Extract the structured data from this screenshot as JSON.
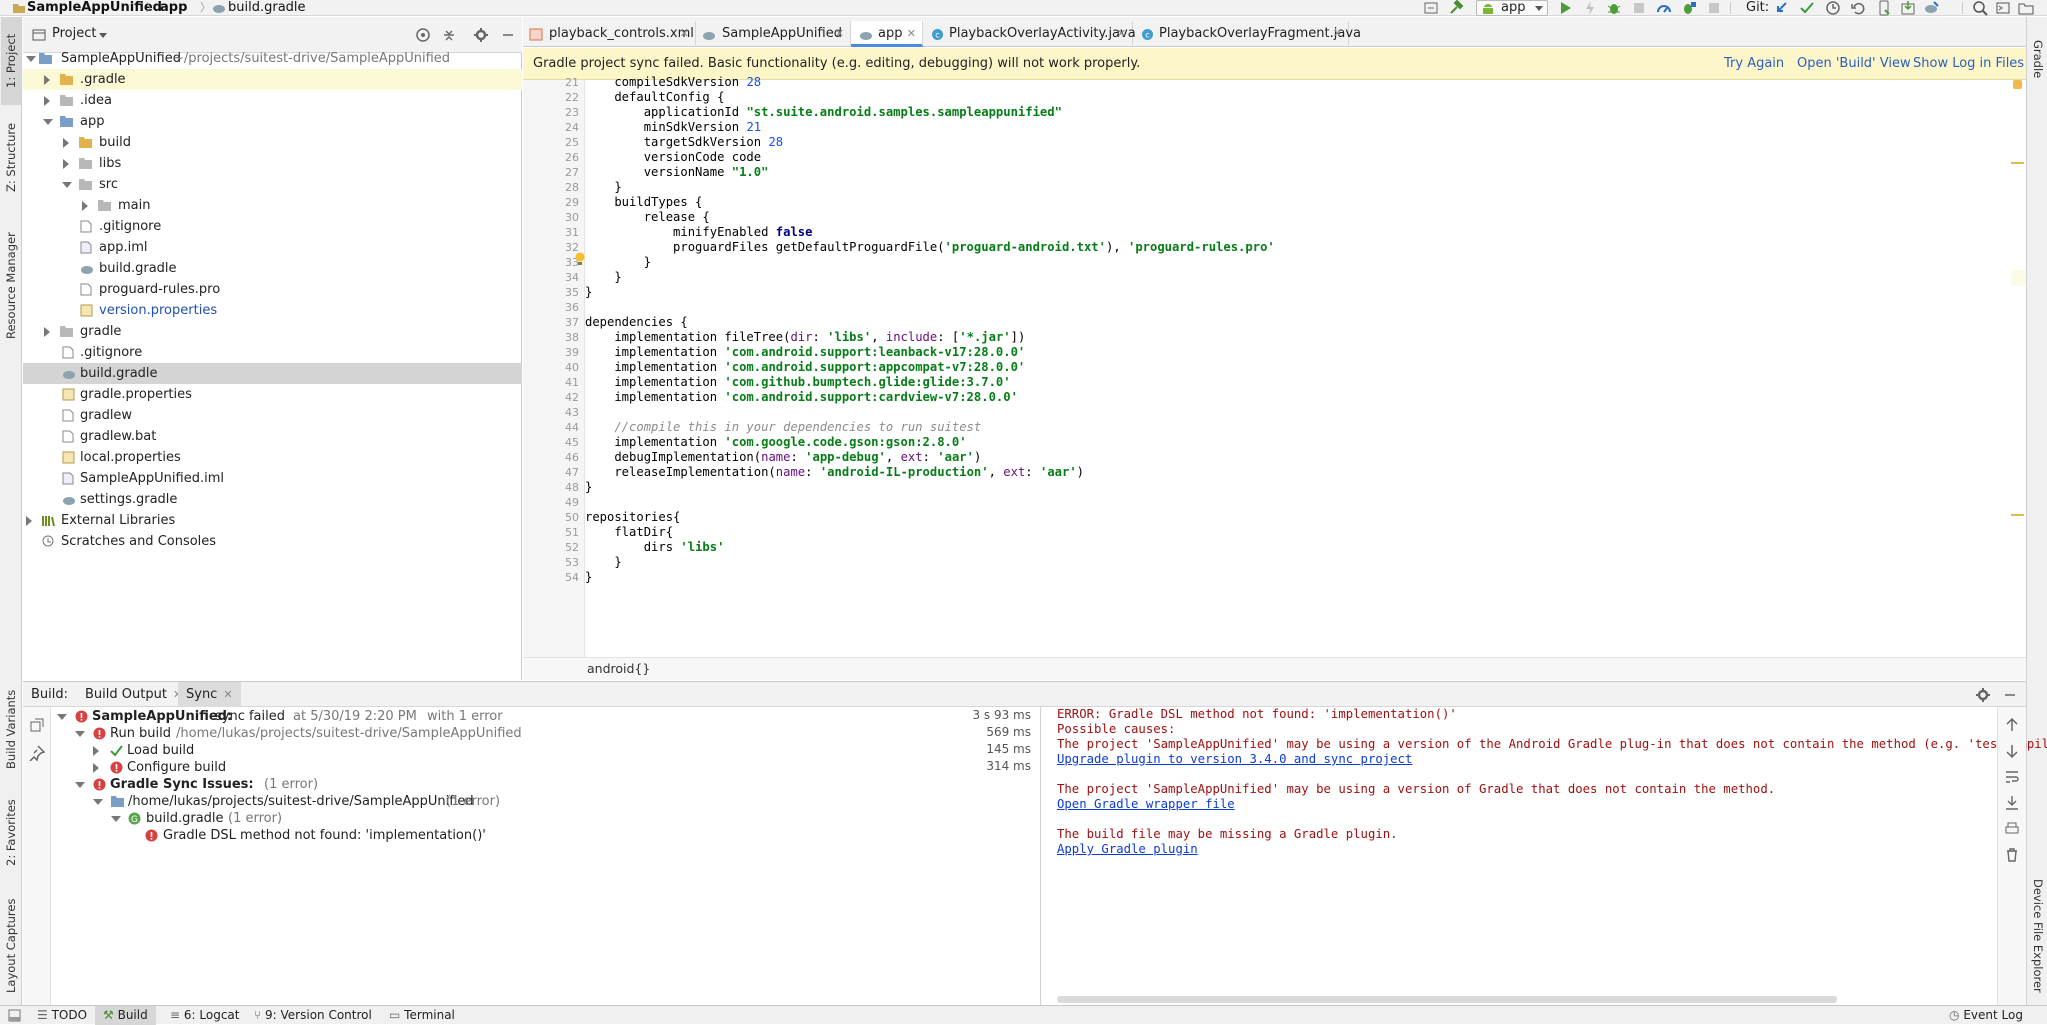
{
  "breadcrumb": {
    "project": "SampleAppUnified",
    "module": "app",
    "file": "build.gradle"
  },
  "toolbar": {
    "run_config": "app",
    "git_label": "Git:"
  },
  "left_tool_tabs": [
    "1: Project",
    "Z: Structure",
    "Resource Manager",
    "Build Variants",
    "2: Favorites",
    "Layout Captures"
  ],
  "right_tool_tabs": [
    "Gradle",
    "Device File Explorer"
  ],
  "project_panel": {
    "title": "Project",
    "root": {
      "name": "SampleAppUnified",
      "path": "~/projects/suitest-drive/SampleAppUnified"
    },
    "items": [
      {
        "label": ".gradle"
      },
      {
        "label": ".idea"
      },
      {
        "label": "app"
      },
      {
        "label": "build"
      },
      {
        "label": "libs"
      },
      {
        "label": "src"
      },
      {
        "label": "main"
      },
      {
        "label": ".gitignore"
      },
      {
        "label": "app.iml"
      },
      {
        "label": "build.gradle"
      },
      {
        "label": "proguard-rules.pro"
      },
      {
        "label": "version.properties"
      },
      {
        "label": "gradle"
      },
      {
        "label": ".gitignore"
      },
      {
        "label": "build.gradle"
      },
      {
        "label": "gradle.properties"
      },
      {
        "label": "gradlew"
      },
      {
        "label": "gradlew.bat"
      },
      {
        "label": "local.properties"
      },
      {
        "label": "SampleAppUnified.iml"
      },
      {
        "label": "settings.gradle"
      },
      {
        "label": "External Libraries"
      },
      {
        "label": "Scratches and Consoles"
      }
    ]
  },
  "editor_tabs": [
    {
      "label": "playback_controls.xml"
    },
    {
      "label": "SampleAppUnified"
    },
    {
      "label": "app"
    },
    {
      "label": "PlaybackOverlayActivity.java"
    },
    {
      "label": "PlaybackOverlayFragment.java"
    }
  ],
  "banner": {
    "message": "Gradle project sync failed. Basic functionality (e.g. editing, debugging) will not work properly.",
    "try_again": "Try Again",
    "open_build_view": "Open 'Build' View",
    "show_log": "Show Log in Files"
  },
  "code_lines": [
    {
      "n": "21",
      "t": "    compileSdkVersion 28"
    },
    {
      "n": "22",
      "t": "    defaultConfig {"
    },
    {
      "n": "23",
      "t": "        applicationId \"st.suite.android.samples.sampleappunified\""
    },
    {
      "n": "24",
      "t": "        minSdkVersion 21"
    },
    {
      "n": "25",
      "t": "        targetSdkVersion 28"
    },
    {
      "n": "26",
      "t": "        versionCode code"
    },
    {
      "n": "27",
      "t": "        versionName \"1.0\""
    },
    {
      "n": "28",
      "t": "    }"
    },
    {
      "n": "29",
      "t": "    buildTypes {"
    },
    {
      "n": "30",
      "t": "        release {"
    },
    {
      "n": "31",
      "t": "            minifyEnabled false"
    },
    {
      "n": "32",
      "t": "            proguardFiles getDefaultProguardFile('proguard-android.txt'), 'proguard-rules.pro'"
    },
    {
      "n": "33",
      "t": "        }"
    },
    {
      "n": "34",
      "t": "    }"
    },
    {
      "n": "35",
      "t": "}"
    },
    {
      "n": "36",
      "t": ""
    },
    {
      "n": "37",
      "t": "dependencies {"
    },
    {
      "n": "38",
      "t": "    implementation fileTree(dir: 'libs', include: ['*.jar'])"
    },
    {
      "n": "39",
      "t": "    implementation 'com.android.support:leanback-v17:28.0.0'"
    },
    {
      "n": "40",
      "t": "    implementation 'com.android.support:appcompat-v7:28.0.0'"
    },
    {
      "n": "41",
      "t": "    implementation 'com.github.bumptech.glide:glide:3.7.0'"
    },
    {
      "n": "42",
      "t": "    implementation 'com.android.support:cardview-v7:28.0.0'"
    },
    {
      "n": "43",
      "t": ""
    },
    {
      "n": "44",
      "t": "    //compile this in your dependencies to run suitest"
    },
    {
      "n": "45",
      "t": "    implementation 'com.google.code.gson:gson:2.8.0'"
    },
    {
      "n": "46",
      "t": "    debugImplementation(name: 'app-debug', ext: 'aar')"
    },
    {
      "n": "47",
      "t": "    releaseImplementation(name: 'android-IL-production', ext: 'aar')"
    },
    {
      "n": "48",
      "t": "}"
    },
    {
      "n": "49",
      "t": ""
    },
    {
      "n": "50",
      "t": "repositories{"
    },
    {
      "n": "51",
      "t": "    flatDir{"
    },
    {
      "n": "52",
      "t": "        dirs 'libs'"
    },
    {
      "n": "53",
      "t": "    }"
    },
    {
      "n": "54",
      "t": "}"
    }
  ],
  "editor_breadcrumb": "android{}",
  "build_panel": {
    "label": "Build:",
    "tabs": [
      "Build Output",
      "Sync"
    ],
    "tree": {
      "root_title": "SampleAppUnified:",
      "root_status": "sync failed",
      "root_meta": "at 5/30/19 2:20 PM",
      "root_errors": "with 1 error",
      "root_time": "3 s 93 ms",
      "run_build": "Run build",
      "run_build_path": "/home/lukas/projects/suitest-drive/SampleAppUnified",
      "run_build_time": "569 ms",
      "load_build": "Load build",
      "load_build_time": "145 ms",
      "configure_build": "Configure build",
      "configure_build_time": "314 ms",
      "sync_issues": "Gradle Sync Issues:",
      "sync_issues_count": "(1 error)",
      "sync_path": "/home/lukas/projects/suitest-drive/SampleAppUnified",
      "sync_path_count": "(1 error)",
      "file": "build.gradle",
      "file_count": "(1 error)",
      "error_msg": "Gradle DSL method not found: 'implementation()'"
    },
    "output": {
      "line1": "ERROR: Gradle DSL method not found: 'implementation()'",
      "line2": "Possible causes:",
      "line3": "The project 'SampleAppUnified' may be using a version of the Android Gradle plug-in that does not contain the method (e.g. 'testCompil",
      "link1": "Upgrade plugin to version 3.4.0 and sync project",
      "line4": "The project 'SampleAppUnified' may be using a version of Gradle that does not contain the method.",
      "link2": "Open Gradle wrapper file",
      "line5": "The build file may be missing a Gradle plugin.",
      "link3": "Apply Gradle plugin"
    }
  },
  "status_bar": {
    "todo": "TODO",
    "build": "Build",
    "logcat": "6: Logcat",
    "vcs": "9: Version Control",
    "terminal": "Terminal",
    "event_log": "Event Log"
  },
  "colors": {
    "banner_bg": "#fdf6c8",
    "link": "#2a5fbf",
    "error_red": "#d64141",
    "string_green": "#067d17",
    "keyword_navy": "#000080"
  }
}
